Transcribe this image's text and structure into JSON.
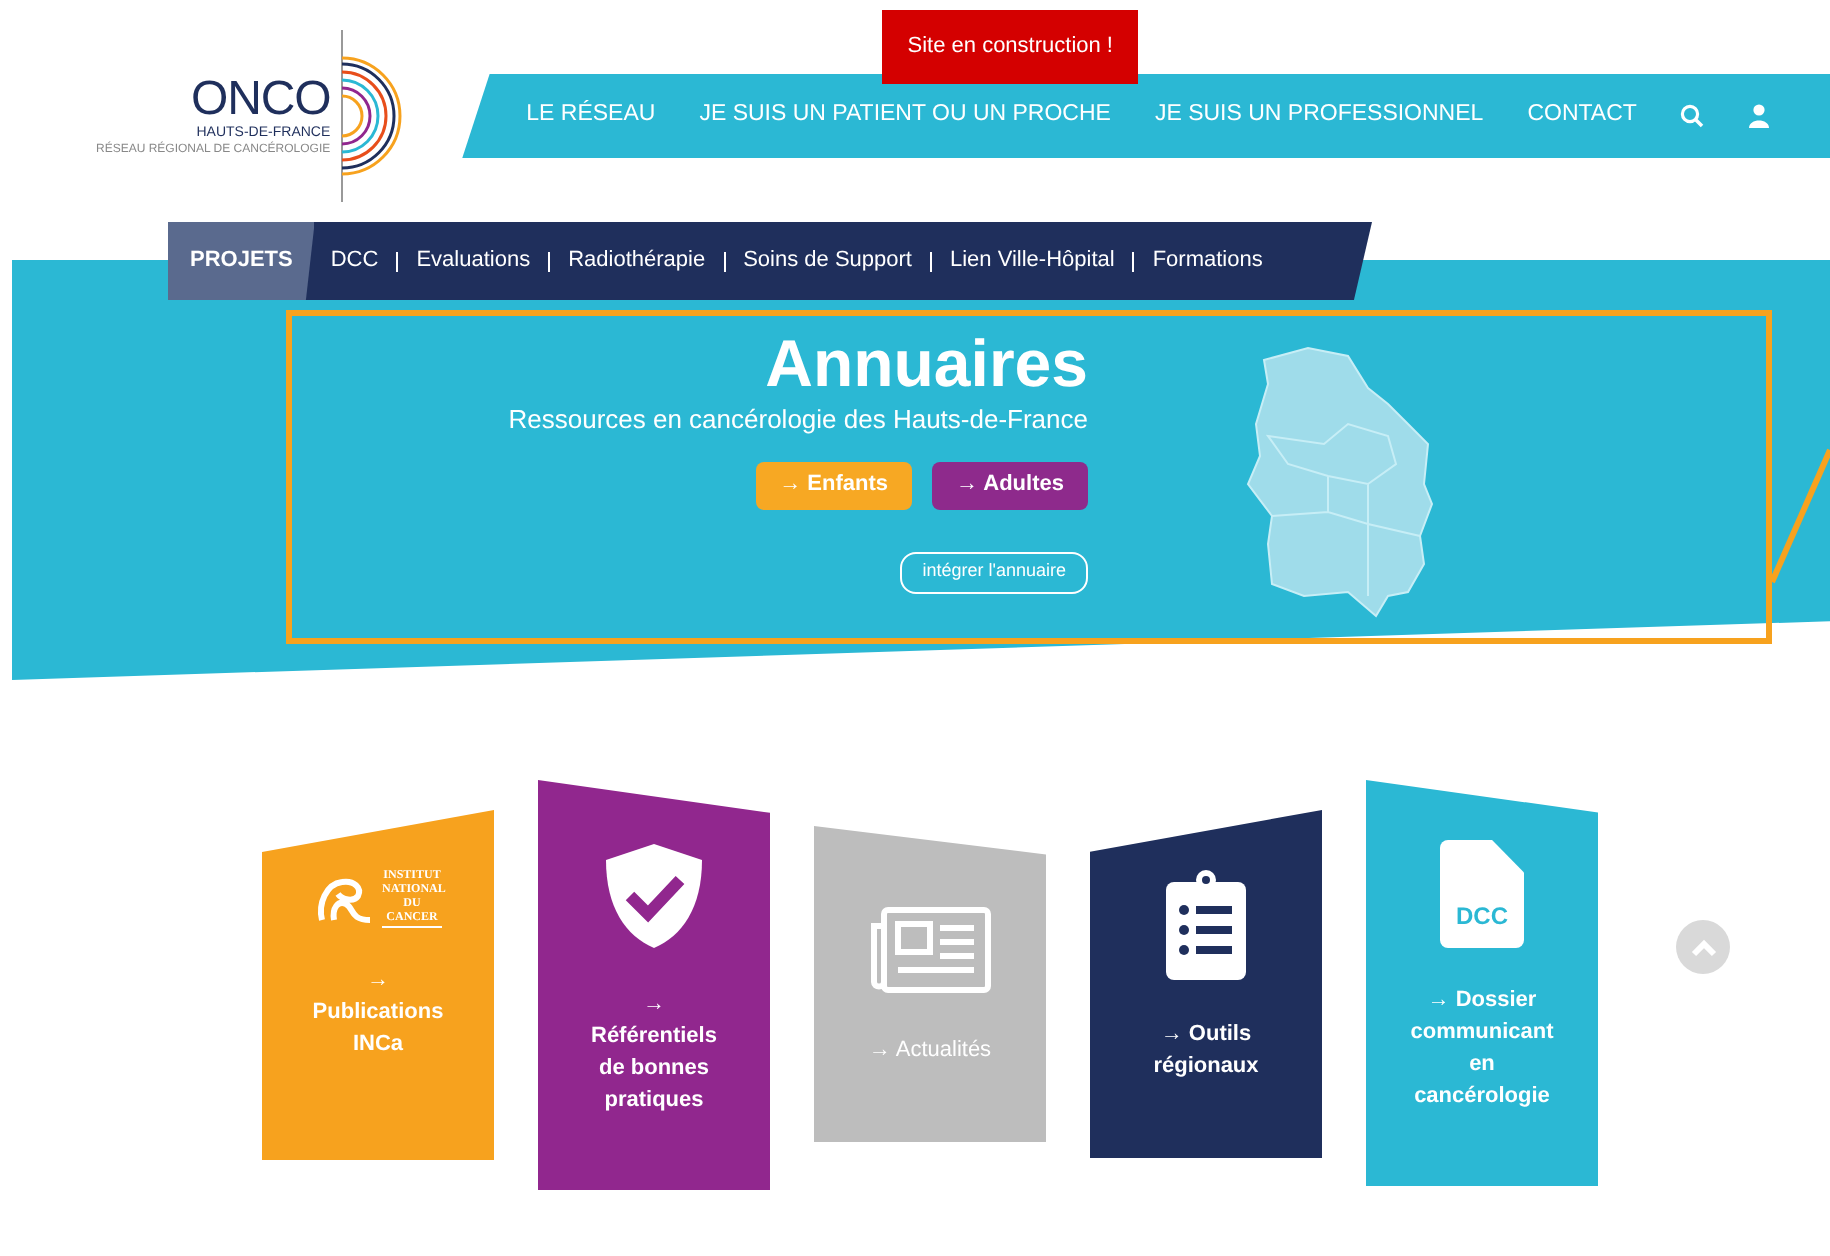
{
  "logo": {
    "name": "ONCO",
    "region": "HAUTS-DE-FRANCE",
    "tagline": "RÉSEAU RÉGIONAL DE CANCÉROLOGIE"
  },
  "notice": "Site en construction !",
  "main_nav": [
    "LE RÉSEAU",
    "JE SUIS UN PATIENT OU UN PROCHE",
    "JE SUIS UN PROFESSIONNEL",
    "CONTACT"
  ],
  "sub_nav": [
    {
      "label": "PROJETS",
      "selected": true
    },
    {
      "label": "DCC",
      "selected": false
    },
    {
      "label": "Evaluations",
      "selected": false
    },
    {
      "label": "Radiothérapie",
      "selected": false
    },
    {
      "label": "Soins de Support",
      "selected": false
    },
    {
      "label": "Lien Ville-Hôpital",
      "selected": false
    },
    {
      "label": "Formations",
      "selected": false
    }
  ],
  "hero": {
    "title": "Annuaires",
    "subtitle": "Ressources en cancérologie des Hauts-de-France",
    "buttons": [
      {
        "label": "→ Enfants",
        "color": "#f7a823"
      },
      {
        "label": "→ Adultes",
        "color": "#8e2a8c"
      }
    ],
    "outline_button": "intégrer l'annuaire"
  },
  "cards": [
    {
      "kind": "inca",
      "logo_text": "INSTITUT NATIONAL DU CANCER",
      "label": "→\nPublications\nINCa",
      "color": "#f7a21e"
    },
    {
      "kind": "shield",
      "label": "→\nRéférentiels\nde bonnes\npratiques",
      "color": "#91278e"
    },
    {
      "kind": "newspaper",
      "label": "→ Actualités",
      "color": "#bdbdbd"
    },
    {
      "kind": "clipboard",
      "label": "→ Outils\nrégionaux",
      "color": "#1f2f5c"
    },
    {
      "kind": "document",
      "icon_text": "DCC",
      "label": "→ Dossier\ncommunicant\nen\ncancérologie",
      "color": "#2bb8d4"
    }
  ]
}
